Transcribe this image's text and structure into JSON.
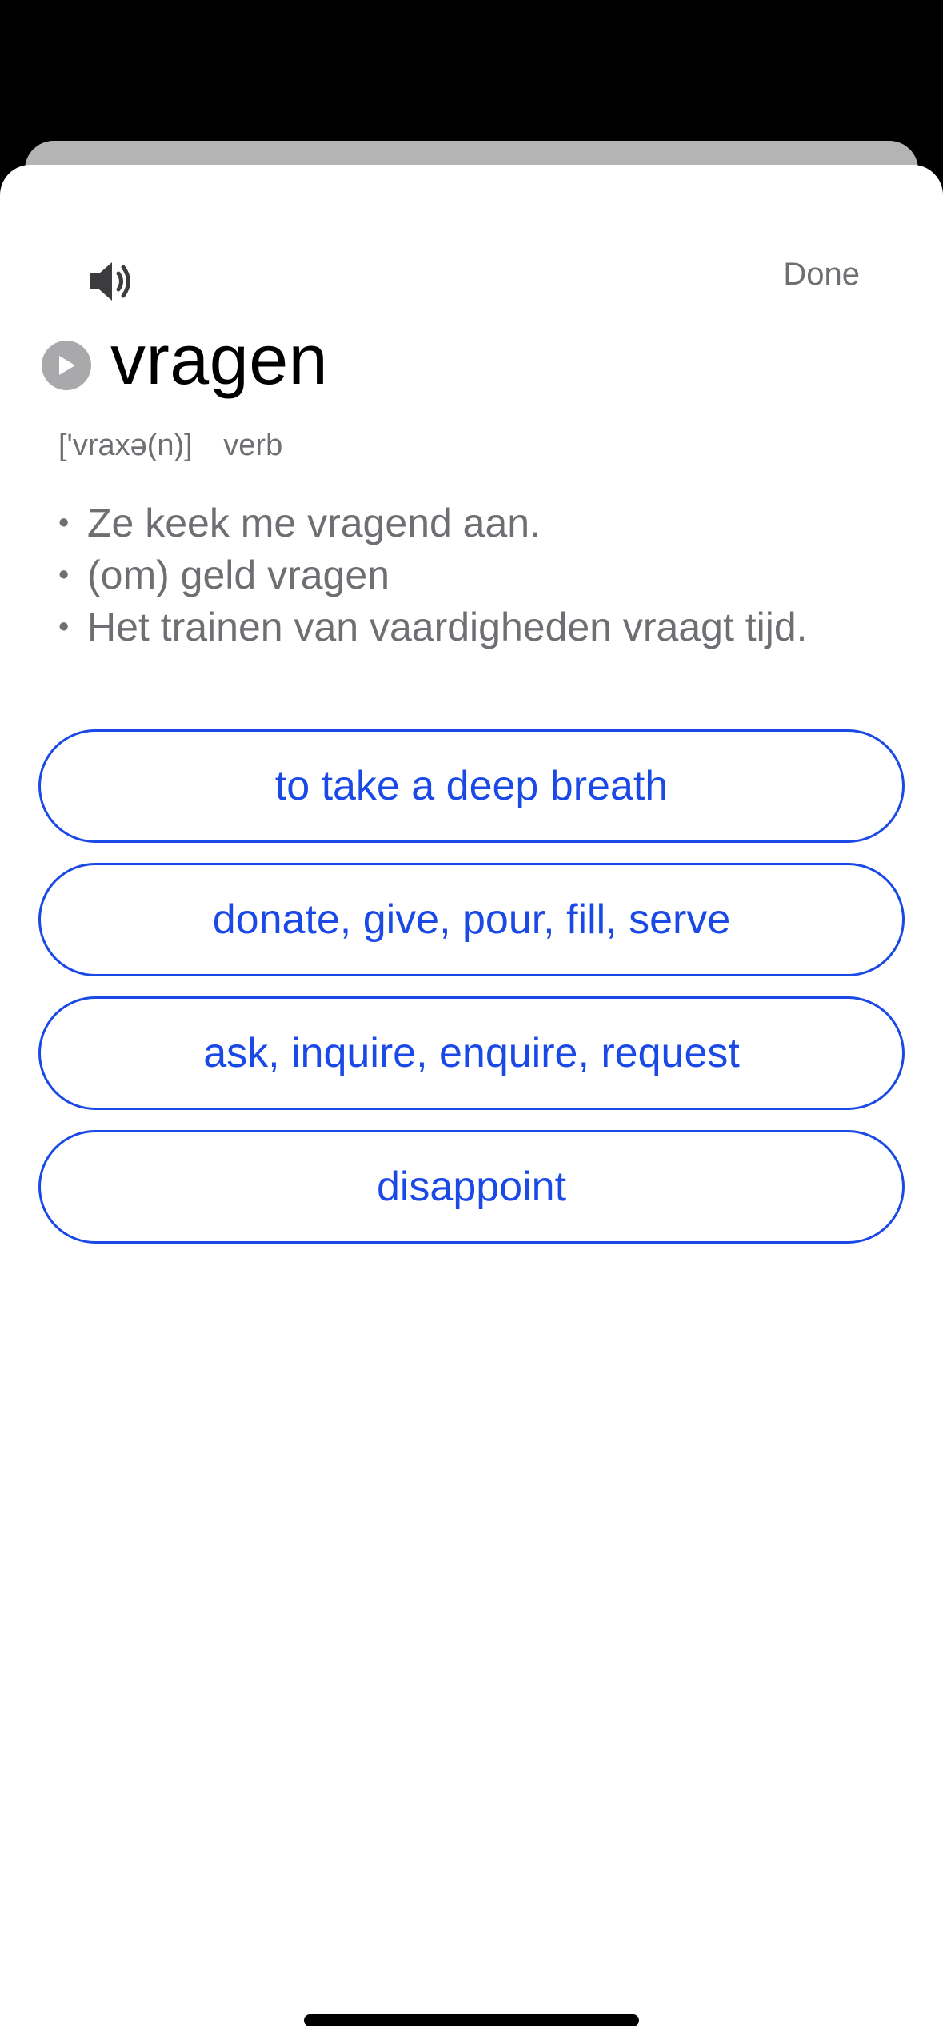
{
  "header": {
    "speaker_icon": "speaker-volume-icon",
    "done_label": "Done"
  },
  "entry": {
    "play_icon": "play-circle-icon",
    "word": "vragen",
    "pronunciation": "['vraxə(n)]",
    "part_of_speech": "verb",
    "examples": [
      "Ze keek me vragend aan.",
      "(om) geld vragen",
      "Het trainen van vaardigheden vraagt tijd."
    ]
  },
  "choices": [
    "to take a deep breath",
    "donate, give, pour, fill, serve",
    "ask, inquire, enquire, request",
    "disappoint"
  ],
  "colors": {
    "accent": "#1a49e6",
    "secondary_text": "#6e6e73",
    "backdrop": "#000000",
    "sheet": "#ffffff"
  }
}
